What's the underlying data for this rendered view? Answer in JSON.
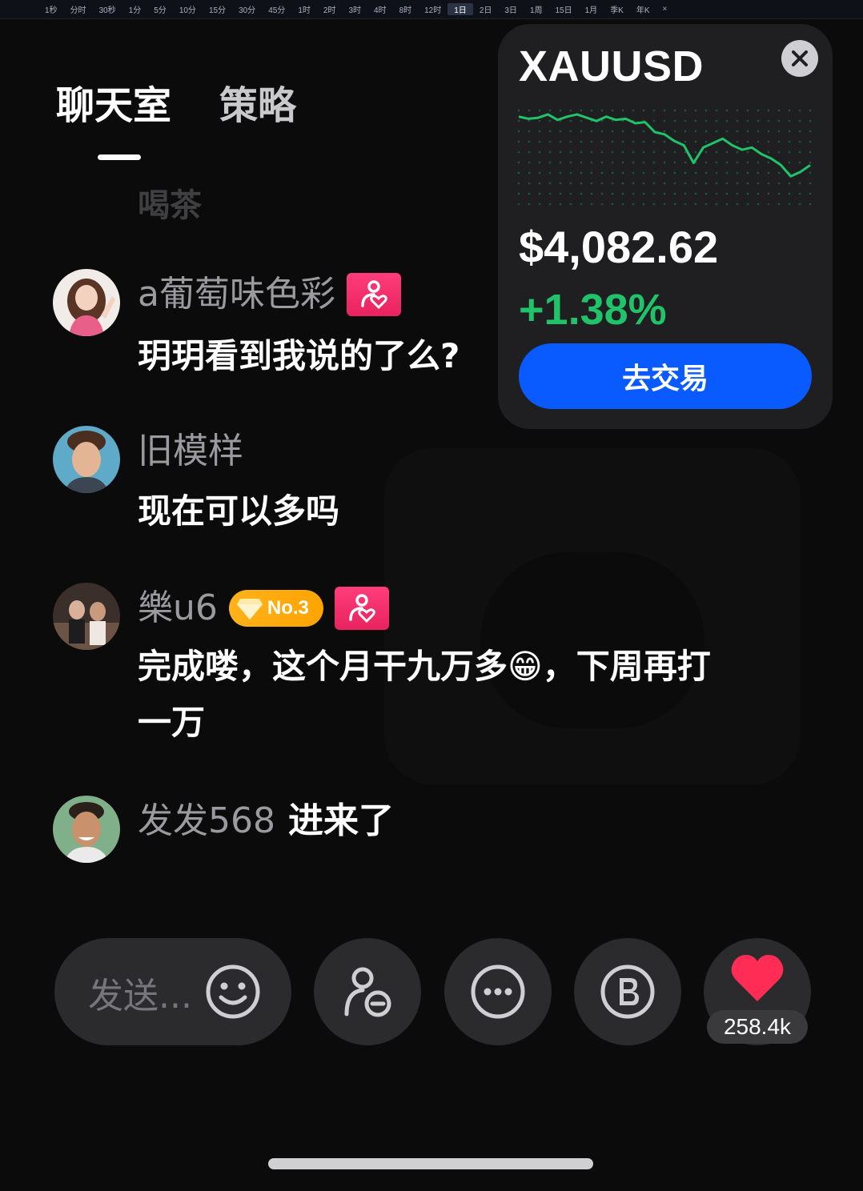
{
  "timeframes": [
    {
      "label": "1秒",
      "active": false
    },
    {
      "label": "分时",
      "active": false
    },
    {
      "label": "30秒",
      "active": false
    },
    {
      "label": "1分",
      "active": false
    },
    {
      "label": "5分",
      "active": false
    },
    {
      "label": "10分",
      "active": false
    },
    {
      "label": "15分",
      "active": false
    },
    {
      "label": "30分",
      "active": false
    },
    {
      "label": "45分",
      "active": false
    },
    {
      "label": "1时",
      "active": false
    },
    {
      "label": "2时",
      "active": false
    },
    {
      "label": "3时",
      "active": false
    },
    {
      "label": "4时",
      "active": false
    },
    {
      "label": "8时",
      "active": false
    },
    {
      "label": "12时",
      "active": false
    },
    {
      "label": "1日",
      "active": true
    },
    {
      "label": "2日",
      "active": false
    },
    {
      "label": "3日",
      "active": false
    },
    {
      "label": "1周",
      "active": false
    },
    {
      "label": "15日",
      "active": false
    },
    {
      "label": "1月",
      "active": false
    },
    {
      "label": "季K",
      "active": false
    },
    {
      "label": "年K",
      "active": false
    },
    {
      "label": "×",
      "active": false
    }
  ],
  "tabs": {
    "chat": "聊天室",
    "strategy": "策略"
  },
  "faded_message": "喝茶",
  "messages": [
    {
      "user": "a葡萄味色彩",
      "badges": [
        "fan"
      ],
      "text_lines": [
        "玥玥看到我说的了么?"
      ]
    },
    {
      "user": "旧模样",
      "badges": [],
      "text_lines": [
        "现在可以多吗"
      ]
    },
    {
      "user": "樂u6",
      "badges": [
        "No.3",
        "fan"
      ],
      "text_lines": [
        "完成喽，这个月干九万多😁，下周再打",
        "一万"
      ]
    },
    {
      "user": "发发568",
      "badges": [],
      "join_text": "进来了"
    }
  ],
  "rank_badge_label": "No.3",
  "ticker": {
    "symbol": "XAUUSD",
    "price": "$4,082.62",
    "change": "+1.38%",
    "trade_button": "去交易",
    "close_icon": "close-icon",
    "up_color": "#20c36a",
    "sparkline": [
      0.64,
      0.62,
      0.63,
      0.66,
      0.61,
      0.64,
      0.66,
      0.63,
      0.6,
      0.64,
      0.61,
      0.62,
      0.58,
      0.59,
      0.5,
      0.48,
      0.42,
      0.38,
      0.22,
      0.36,
      0.4,
      0.44,
      0.38,
      0.34,
      0.36,
      0.3,
      0.26,
      0.2,
      0.1,
      0.14,
      0.2
    ]
  },
  "input": {
    "placeholder": "发送..."
  },
  "actions": {
    "like_count": "258.4k",
    "icons": [
      "smile-icon",
      "user-minus-icon",
      "more-icon",
      "bitcoin-icon",
      "heart-icon"
    ]
  },
  "colors": {
    "accent_blue": "#0a5bff",
    "fan_badge": "#ff3d7a",
    "rank_badge": "#ffaa10",
    "heart": "#ff2d55"
  }
}
